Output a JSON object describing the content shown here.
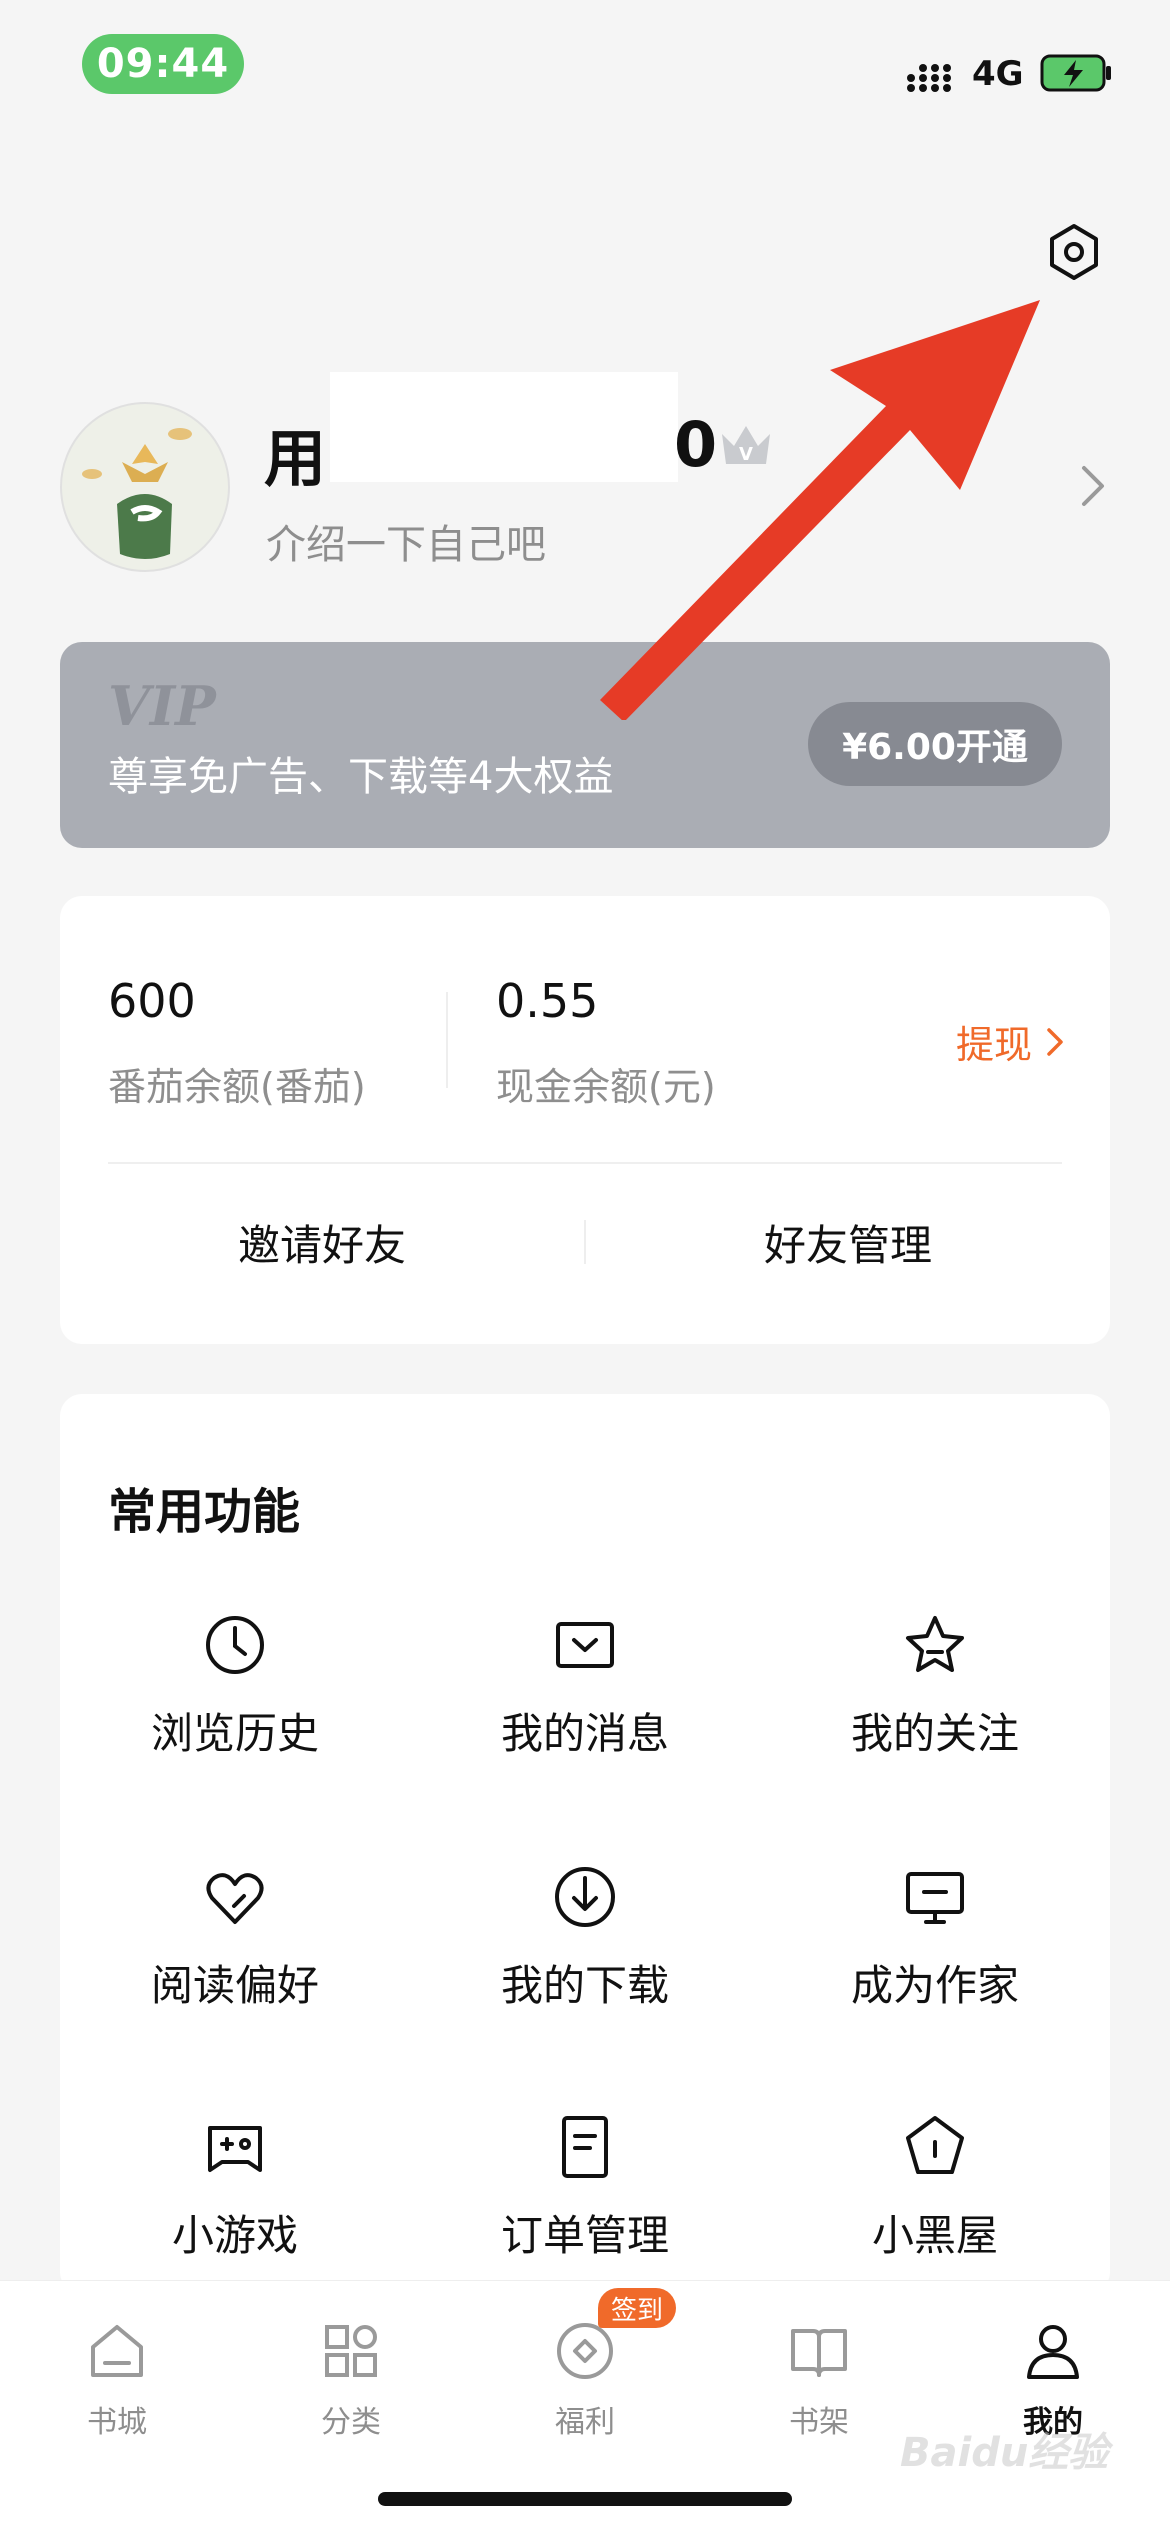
{
  "status_bar": {
    "time": "09:44",
    "network": "4G"
  },
  "profile": {
    "name_visible_start": "用",
    "name_visible_end": "0",
    "bio": "介绍一下自己吧"
  },
  "vip": {
    "title": "VIP",
    "description": "尊享免广告、下载等4大权益",
    "button_label": "¥6.00开通"
  },
  "balance": {
    "tomato_value": "600",
    "tomato_label": "番茄余额(番茄)",
    "cash_value": "0.55",
    "cash_label": "现金余额(元)",
    "withdraw_label": "提现",
    "invite_label": "邀请好友",
    "friends_label": "好友管理"
  },
  "functions": {
    "title": "常用功能",
    "items": [
      {
        "label": "浏览历史",
        "icon": "clock-icon"
      },
      {
        "label": "我的消息",
        "icon": "message-icon"
      },
      {
        "label": "我的关注",
        "icon": "star-icon"
      },
      {
        "label": "阅读偏好",
        "icon": "heart-icon"
      },
      {
        "label": "我的下载",
        "icon": "download-icon"
      },
      {
        "label": "成为作家",
        "icon": "monitor-icon"
      },
      {
        "label": "小游戏",
        "icon": "gamepad-icon"
      },
      {
        "label": "订单管理",
        "icon": "document-icon"
      },
      {
        "label": "小黑屋",
        "icon": "pentagon-icon"
      }
    ]
  },
  "nav": {
    "items": [
      {
        "label": "书城",
        "icon": "home-icon"
      },
      {
        "label": "分类",
        "icon": "grid-icon"
      },
      {
        "label": "福利",
        "icon": "coin-icon"
      },
      {
        "label": "书架",
        "icon": "book-icon"
      },
      {
        "label": "我的",
        "icon": "person-icon"
      }
    ],
    "active": "我的",
    "badge": "签到"
  },
  "watermark": "Baidu经验",
  "colors": {
    "accent_orange": "#f06a2a",
    "status_green": "#5bc86a",
    "vip_gray": "#aaadb4",
    "annotation_red": "#e63b26"
  }
}
